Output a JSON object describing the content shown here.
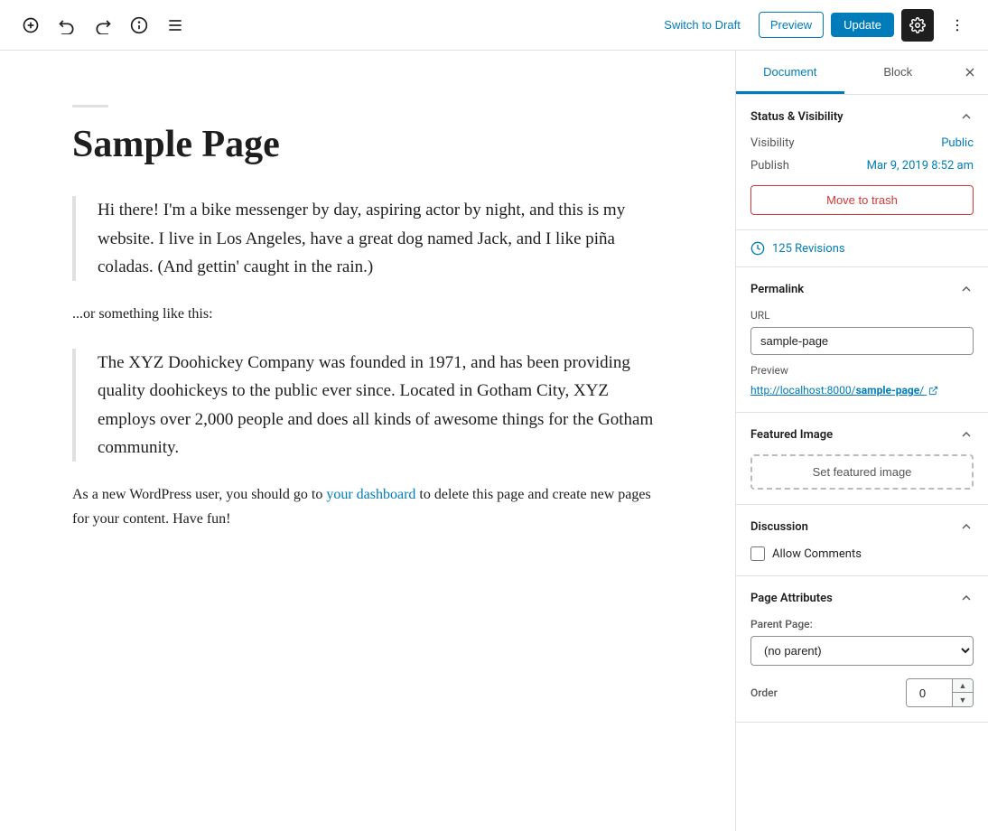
{
  "toolbar": {
    "switch_draft_label": "Switch to Draft",
    "preview_label": "Preview",
    "update_label": "Update"
  },
  "editor": {
    "separator": "",
    "title": "Sample Page",
    "blockquote1": "Hi there! I'm a bike messenger by day, aspiring actor by night, and this is my website. I live in Los Angeles, have a great dog named Jack, and I like piña coladas. (And gettin' caught in the rain.)",
    "paragraph1": "...or something like this:",
    "blockquote2": "The XYZ Doohickey Company was founded in 1971, and has been providing quality doohickeys to the public ever since. Located in Gotham City, XYZ employs over 2,000 people and does all kinds of awesome things for the Gotham community.",
    "paragraph2_before": "As a new WordPress user, you should go to ",
    "paragraph2_link": "your dashboard",
    "paragraph2_link_href": "#",
    "paragraph2_after": " to delete this page and create new pages for your content. Have fun!"
  },
  "sidebar": {
    "tab_document": "Document",
    "tab_block": "Block",
    "status_visibility_title": "Status & Visibility",
    "visibility_label": "Visibility",
    "visibility_value": "Public",
    "publish_label": "Publish",
    "publish_value": "Mar 9, 2019 8:52 am",
    "trash_label": "Move to trash",
    "revisions_label": "125 Revisions",
    "permalink_title": "Permalink",
    "url_label": "URL",
    "url_value": "sample-page",
    "preview_label": "Preview",
    "preview_link_before": "http://localhost:8000/",
    "preview_link_anchor": "sample-page",
    "preview_link_after": "/",
    "featured_image_title": "Featured Image",
    "set_featured_label": "Set featured image",
    "discussion_title": "Discussion",
    "allow_comments_label": "Allow Comments",
    "page_attributes_title": "Page Attributes",
    "parent_page_label": "Parent Page:",
    "parent_page_option": "(no parent)",
    "order_label": "Order",
    "order_value": "0"
  }
}
